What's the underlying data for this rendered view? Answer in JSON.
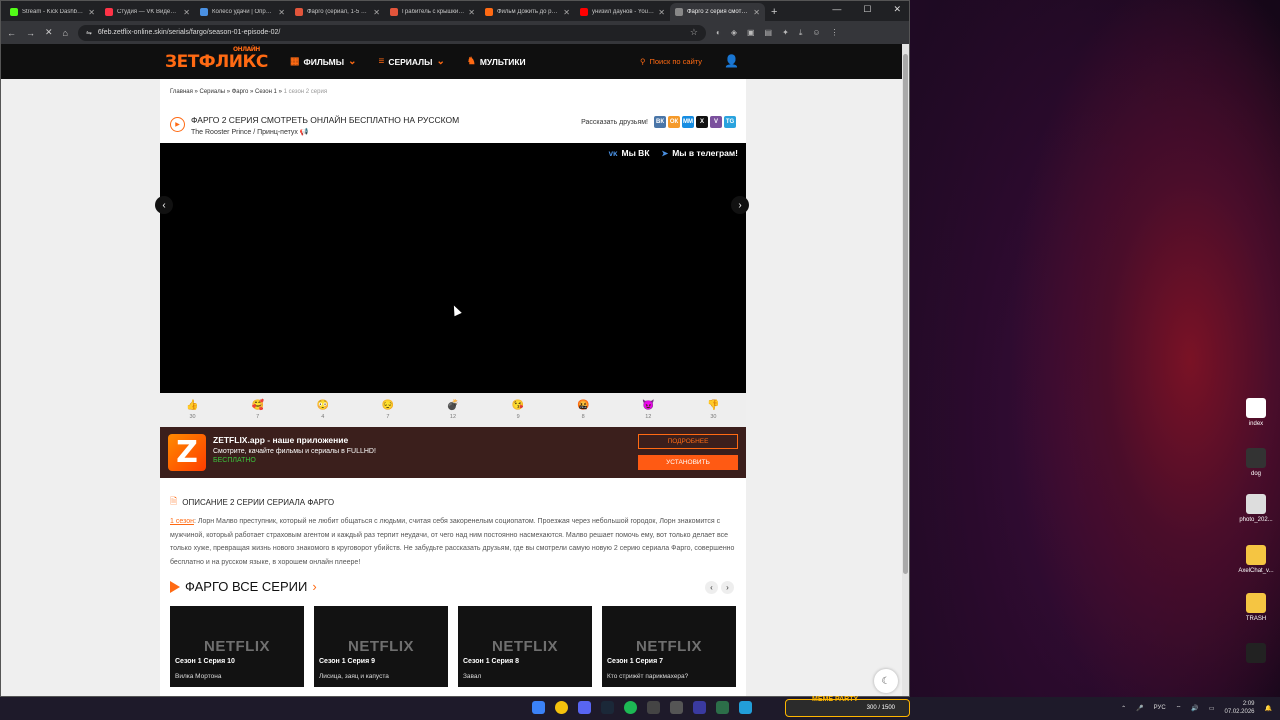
{
  "browser": {
    "tabs": [
      {
        "label": "Stream - Kick Dashboard",
        "color": "#53fc18"
      },
      {
        "label": "Студия — VK Видео Бизнес",
        "color": "#ff3347"
      },
      {
        "label": "Колесо удачи | Определ...",
        "color": "#4a90e2"
      },
      {
        "label": "Фарго (сериал, 1-5 сезон...",
        "color": "#e2553b"
      },
      {
        "label": "Грабитель с крышки, 2...",
        "color": "#e2553b"
      },
      {
        "label": "Фильм Дожить до рас...",
        "color": "#ff6a13"
      },
      {
        "label": "унизил даунов - YouTube",
        "color": "#ff0000"
      },
      {
        "label": "Фарго 2 серия смотрет...",
        "color": "#888888"
      }
    ],
    "url": "6feb.zetflix-online.skin/serials/fargo/season-01-episode-02/"
  },
  "site": {
    "logo": "ЗЕТФЛИКС",
    "logo_sup": "ОНЛАЙН",
    "menu": [
      "ФИЛЬМЫ",
      "СЕРИАЛЫ",
      "МУЛЬТИКИ"
    ],
    "search": "Поиск по сайту"
  },
  "breadcrumb": {
    "items": [
      "Главная",
      "Сериалы",
      "Фарго",
      "Сезон 1"
    ],
    "sep": " » ",
    "current": "1 сезон 2 серия"
  },
  "title": "Фарго 2 серия смотреть онлайн бесплатно на русском",
  "subtitle": "The Rooster Prince / Принц-петух 📢",
  "share": {
    "label": "Рассказать друзьям!",
    "icons": [
      "ВК",
      "ОК",
      "ММ",
      "X",
      "V",
      "TG"
    ]
  },
  "player": {
    "vk": "Мы ВК",
    "tg": "Мы в телеграм!"
  },
  "reactions": [
    {
      "emoji": "👍",
      "count": "30"
    },
    {
      "emoji": "🥰",
      "count": "7"
    },
    {
      "emoji": "😳",
      "count": "4"
    },
    {
      "emoji": "😔",
      "count": "7"
    },
    {
      "emoji": "💣",
      "count": "12"
    },
    {
      "emoji": "😘",
      "count": "9"
    },
    {
      "emoji": "🤬",
      "count": "8"
    },
    {
      "emoji": "😈",
      "count": "12"
    },
    {
      "emoji": "👎",
      "count": "30"
    }
  ],
  "promo": {
    "title": "ZETFLIX.app - наше приложение",
    "text": "Смотрите, качайте фильмы и сериалы в FULLHD!",
    "free": "БЕСПЛАТНО",
    "more": "ПОДРОБНЕЕ",
    "install": "УСТАНОВИТЬ"
  },
  "description": {
    "heading": "Описание 2 серии сериала Фарго",
    "link": "1 сезон",
    "text": ": Лорн Малво преступник, который не любит общаться с людьми, считая себя закоренелым социопатом. Проезжая через небольшой городок, Лорн знакомится с мужчиной, который работает страховым агентом и каждый раз терпит неудачи, от чего над ним постоянно насмехаются. Малво решает помочь ему, вот только делает все только хуже, превращая жизнь нового знакомого в круговорот убийств. Не забудьте рассказать друзьям, где вы смотрели самую новую 2 серию сериала Фарго, совершенно бесплатно и на русском языке, в хорошем онлайн плеере!"
  },
  "series": {
    "heading": "ФАРГО ВСЕ СЕРИИ",
    "cards": [
      {
        "thumb": "NETFLIX",
        "ep": "Сезон 1 Серия 10",
        "name": "Вилка Мортона"
      },
      {
        "thumb": "NETFLIX",
        "ep": "Сезон 1 Серия 9",
        "name": "Лисица, заяц и капуста"
      },
      {
        "thumb": "NETFLIX",
        "ep": "Сезон 1 Серия 8",
        "name": "Завал"
      },
      {
        "thumb": "NETFLIX",
        "ep": "Сезон 1 Серия 7",
        "name": "Кто стрижёт парикмахера?"
      }
    ]
  },
  "desktop": [
    {
      "label": "index",
      "color": "#ffffff"
    },
    {
      "label": "dog",
      "color": "#333333"
    },
    {
      "label": "photo_202...",
      "color": "#dddddd"
    },
    {
      "label": "AxelChat_v...",
      "color": "#f5c542"
    },
    {
      "label": "TRASH",
      "color": "#f5c542"
    },
    {
      "label": "",
      "color": "#222222"
    }
  ],
  "taskbar": {
    "meme": "MEME PARTY",
    "meme_count": "300 / 1500",
    "lang": "РУС",
    "time": "2:09",
    "date": "07.02.2026"
  }
}
